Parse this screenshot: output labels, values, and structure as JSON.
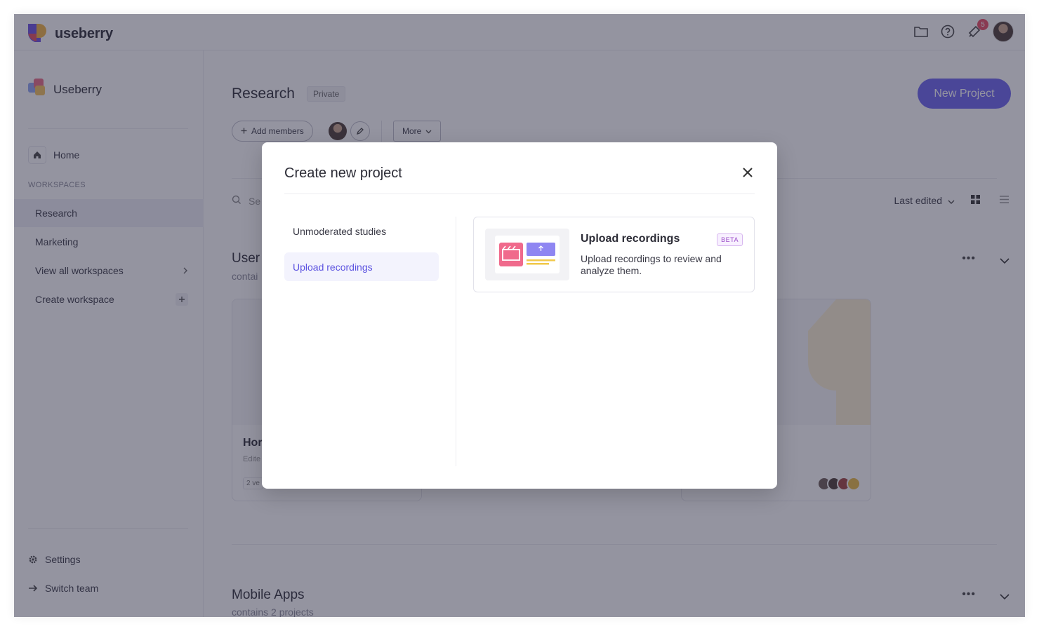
{
  "app": {
    "brand_name": "useberry",
    "notification_count": "5",
    "team_name": "Useberry"
  },
  "sidebar": {
    "home_label": "Home",
    "workspaces_heading": "WORKSPACES",
    "items": [
      {
        "label": "Research",
        "active": true
      },
      {
        "label": "Marketing"
      },
      {
        "label": "View all workspaces"
      },
      {
        "label": "Create workspace"
      }
    ],
    "settings_label": "Settings",
    "switch_team_label": "Switch team"
  },
  "workspace": {
    "title": "Research",
    "privacy_badge": "Private",
    "add_members_label": "Add members",
    "more_label": "More",
    "new_project_label": "New Project",
    "search_placeholder": "Se",
    "sort_label": "Last edited",
    "sections": [
      {
        "title": "User",
        "subtitle": "contai"
      },
      {
        "title": "Mobile Apps",
        "subtitle": "contains 2 projects"
      }
    ],
    "cards": [
      {
        "title": "Hor",
        "meta": "Edite",
        "tag": "2 ve"
      }
    ]
  },
  "modal": {
    "title": "Create new project",
    "tabs": [
      {
        "label": "Unmoderated studies",
        "active": false
      },
      {
        "label": "Upload recordings",
        "active": true
      }
    ],
    "option": {
      "title": "Upload recordings",
      "badge": "BETA",
      "description": "Upload recordings to review and analyze them."
    }
  },
  "colors": {
    "accent": "#6b62ee",
    "overlay": "#2a2a42",
    "beta_badge": "#9b4ec8"
  }
}
